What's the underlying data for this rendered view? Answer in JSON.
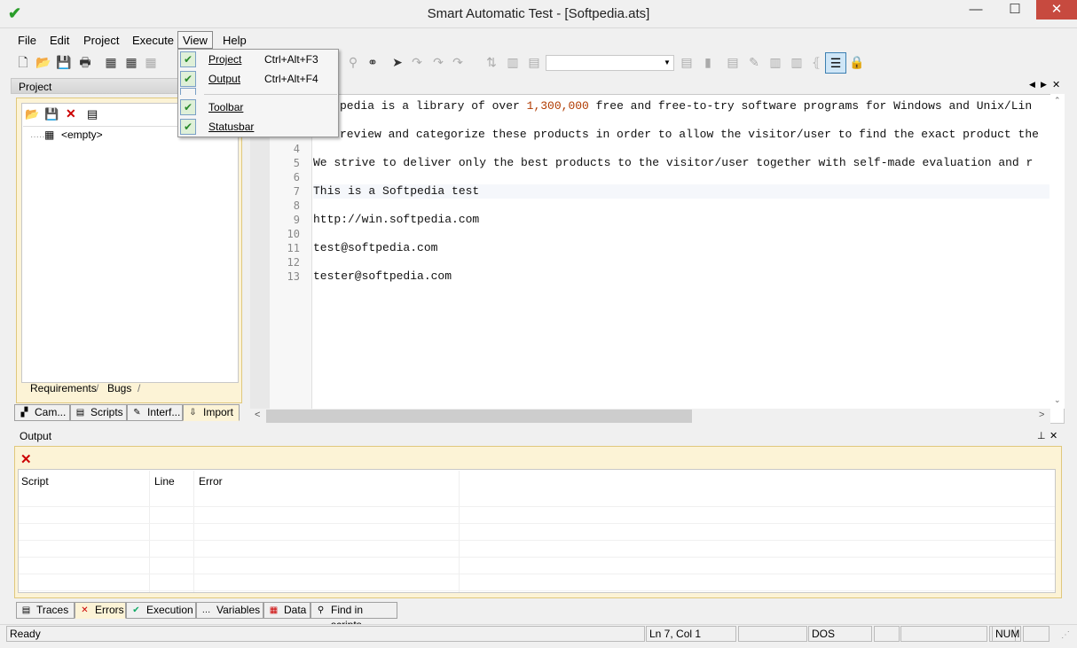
{
  "window": {
    "title": "Smart Automatic Test - [Softpedia.ats]",
    "minimize": "—",
    "maximize": "☐",
    "close": "✕"
  },
  "menu": {
    "items": [
      "File",
      "Edit",
      "Project",
      "Execute",
      "View",
      "Help"
    ]
  },
  "view_menu": {
    "items": [
      {
        "label": "Project",
        "shortcut": "Ctrl+Alt+F3",
        "checked": true
      },
      {
        "label": "Output",
        "shortcut": "Ctrl+Alt+F4",
        "checked": true
      },
      {
        "label": "Toolbar",
        "shortcut": "",
        "checked": true
      },
      {
        "label": "Statusbar",
        "shortcut": "",
        "checked": true
      }
    ]
  },
  "project_panel": {
    "title": "Project",
    "tree_item": "<empty>",
    "inner_tabs": [
      "Requirements",
      "Bugs"
    ],
    "bottom_tabs": [
      "Cam...",
      "Scripts",
      "Interf...",
      "Import"
    ]
  },
  "editor": {
    "lines": [
      {
        "n": "",
        "text": "pedia is a library of over ",
        "num": "1,300,000",
        "rest": " free and free-to-try software programs for Windows and Unix/Lin"
      },
      {
        "n": "",
        "text": "review and categorize these products in order to allow the visitor/user to find the exact product the",
        "num": "",
        "rest": ""
      },
      {
        "n": "4",
        "text": "",
        "num": "",
        "rest": ""
      },
      {
        "n": "5",
        "text": "We strive to deliver only the best products to the visitor/user together with self-made evaluation and r",
        "num": "",
        "rest": ""
      },
      {
        "n": "6",
        "text": "",
        "num": "",
        "rest": ""
      },
      {
        "n": "7",
        "text": "This is a Softpedia test",
        "num": "",
        "rest": ""
      },
      {
        "n": "8",
        "text": "",
        "num": "",
        "rest": ""
      },
      {
        "n": "9",
        "text": "http://win.softpedia.com",
        "num": "",
        "rest": ""
      },
      {
        "n": "10",
        "text": "",
        "num": "",
        "rest": ""
      },
      {
        "n": "11",
        "text": "test@softpedia.com",
        "num": "",
        "rest": ""
      },
      {
        "n": "12",
        "text": "",
        "num": "",
        "rest": ""
      },
      {
        "n": "13",
        "text": "tester@softpedia.com",
        "num": "",
        "rest": ""
      }
    ]
  },
  "output_panel": {
    "title": "Output",
    "columns": [
      "Script",
      "Line",
      "Error"
    ],
    "tabs": [
      "Traces",
      "Errors",
      "Execution",
      "Variables",
      "Data",
      "Find in scripts"
    ]
  },
  "statusbar": {
    "status": "Ready",
    "position": "Ln 7, Col 1",
    "format": "DOS",
    "numlock": "NUM"
  }
}
